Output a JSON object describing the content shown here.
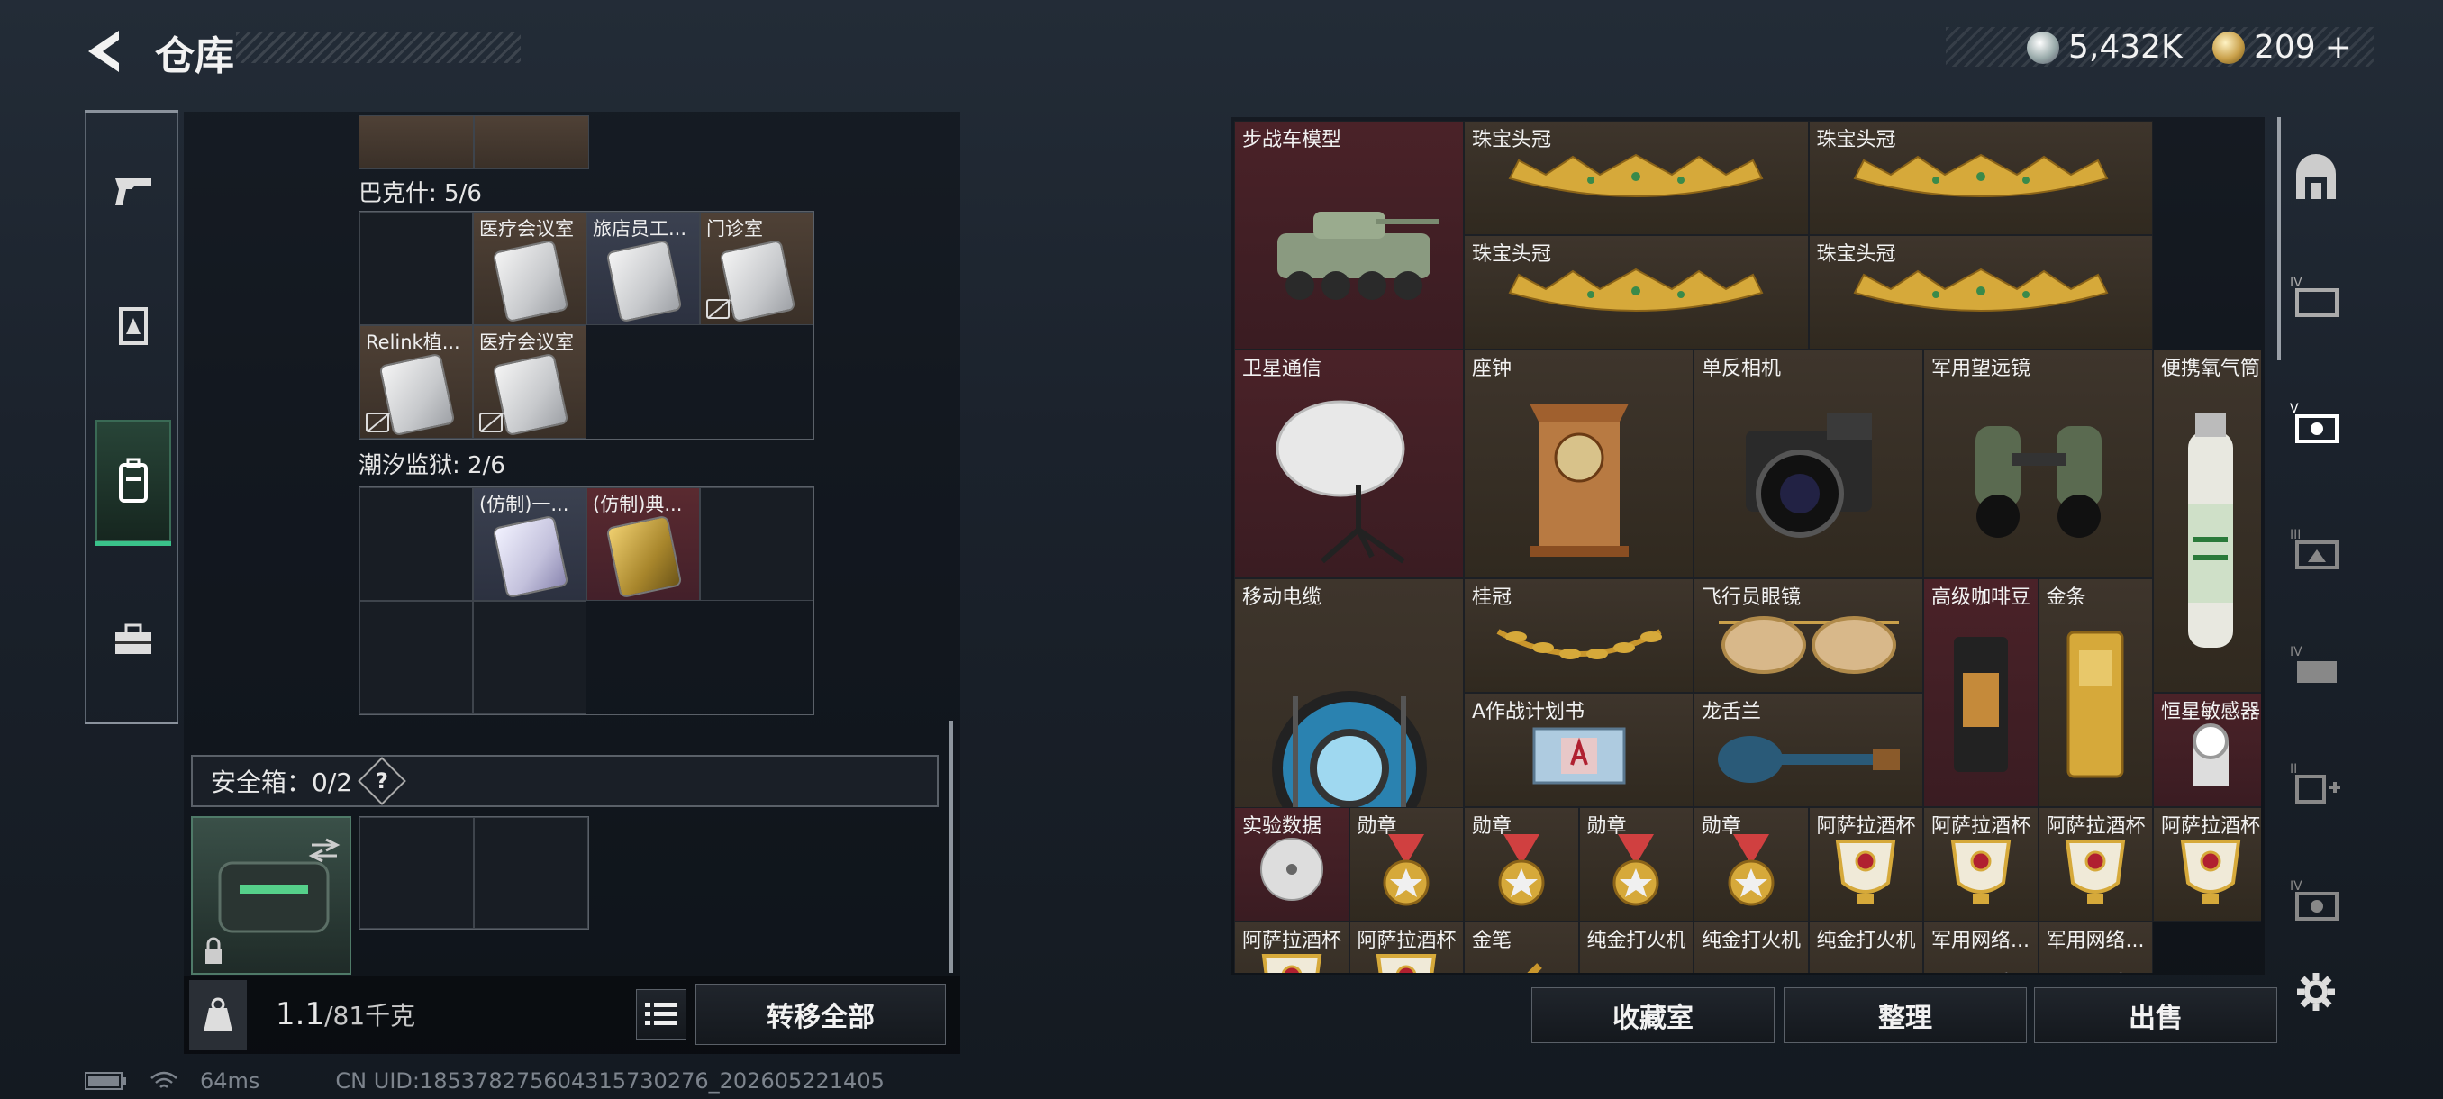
{
  "header": {
    "title": "仓库",
    "back_icon": "back-arrow-icon"
  },
  "currency": {
    "silver": "5,432K",
    "gold": "209",
    "plus": "+"
  },
  "left_tabs": [
    {
      "icon": "pistol-icon"
    },
    {
      "icon": "armor-icon"
    },
    {
      "icon": "backpack-icon",
      "active": true
    },
    {
      "icon": "toolbox-icon"
    }
  ],
  "sections": [
    {
      "label": "巴克什: 5/6",
      "cells": [
        "",
        "医疗会议室",
        "旅店员工...",
        "门诊室",
        "Relink植...",
        "医疗会议室"
      ]
    },
    {
      "label": "潮汐监狱: 2/6",
      "cells": [
        "",
        "(仿制)一...",
        "(仿制)典...",
        ""
      ]
    }
  ],
  "safe": {
    "label": "安全箱：0/2",
    "help": "?"
  },
  "weight": {
    "current": "1.1",
    "max": "/81千克"
  },
  "transfer_all": "转移全部",
  "items": [
    {
      "name": "步战车模型"
    },
    {
      "name": "珠宝头冠"
    },
    {
      "name": "珠宝头冠"
    },
    {
      "name": "珠宝头冠"
    },
    {
      "name": "珠宝头冠"
    },
    {
      "name": "卫星通信"
    },
    {
      "name": "座钟"
    },
    {
      "name": "单反相机"
    },
    {
      "name": "军用望远镜"
    },
    {
      "name": "便携氧气筒"
    },
    {
      "name": "移动电缆"
    },
    {
      "name": "桂冠"
    },
    {
      "name": "飞行员眼镜"
    },
    {
      "name": "高级咖啡豆"
    },
    {
      "name": "金条"
    },
    {
      "name": "A作战计划书"
    },
    {
      "name": "龙舌兰"
    },
    {
      "name": "恒星敏感器"
    },
    {
      "name": "实验数据"
    },
    {
      "name": "勋章"
    },
    {
      "name": "勋章"
    },
    {
      "name": "勋章"
    },
    {
      "name": "勋章"
    },
    {
      "name": "阿萨拉酒杯"
    },
    {
      "name": "阿萨拉酒杯"
    },
    {
      "name": "阿萨拉酒杯"
    },
    {
      "name": "阿萨拉酒杯"
    },
    {
      "name": "阿萨拉酒杯"
    },
    {
      "name": "阿萨拉酒杯"
    },
    {
      "name": "金笔"
    },
    {
      "name": "纯金打火机"
    },
    {
      "name": "纯金打火机"
    },
    {
      "name": "纯金打火机"
    },
    {
      "name": "军用网络..."
    },
    {
      "name": "军用网络..."
    }
  ],
  "buttons": {
    "collection": "收藏室",
    "sort": "整理",
    "sell": "出售"
  },
  "status": {
    "ping": "64ms",
    "uid": "CN UID:1853782756043157302​76_202605221405"
  }
}
